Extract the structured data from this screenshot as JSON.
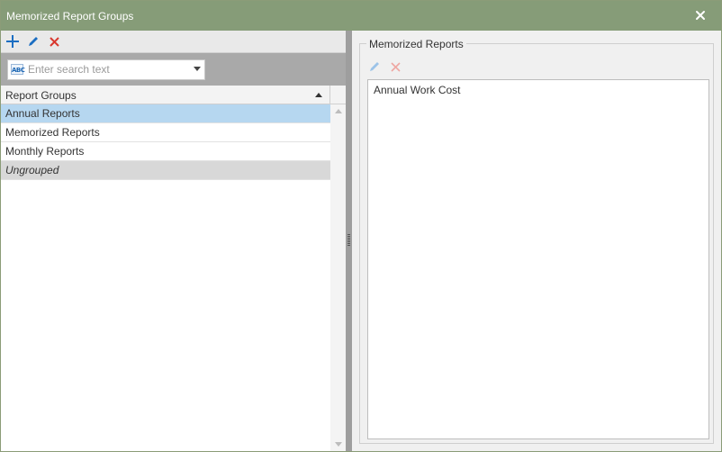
{
  "window": {
    "title": "Memorized Report Groups"
  },
  "left_pane": {
    "toolbar": {
      "add_icon": "plus-icon",
      "edit_icon": "pencil-icon",
      "delete_icon": "x-icon"
    },
    "search": {
      "placeholder": "Enter search text",
      "value": "",
      "icon_label": "ABC"
    },
    "grid": {
      "column_header": "Report Groups",
      "sort": "ascending",
      "rows": [
        {
          "label": "Annual Reports",
          "state": "selected"
        },
        {
          "label": "Memorized Reports",
          "state": "normal"
        },
        {
          "label": "Monthly Reports",
          "state": "normal"
        },
        {
          "label": "Ungrouped",
          "state": "group"
        }
      ]
    }
  },
  "right_pane": {
    "group_label": "Memorized Reports",
    "toolbar": {
      "edit_icon": "pencil-icon",
      "delete_icon": "x-icon",
      "enabled": false
    },
    "items": [
      {
        "label": "Annual Work Cost"
      }
    ]
  },
  "colors": {
    "titlebar": "#869c78",
    "selected_row": "#b6d7f0",
    "group_row": "#d8d8d8",
    "add_icon": "#1b6ec2",
    "delete_icon": "#d9382e"
  }
}
